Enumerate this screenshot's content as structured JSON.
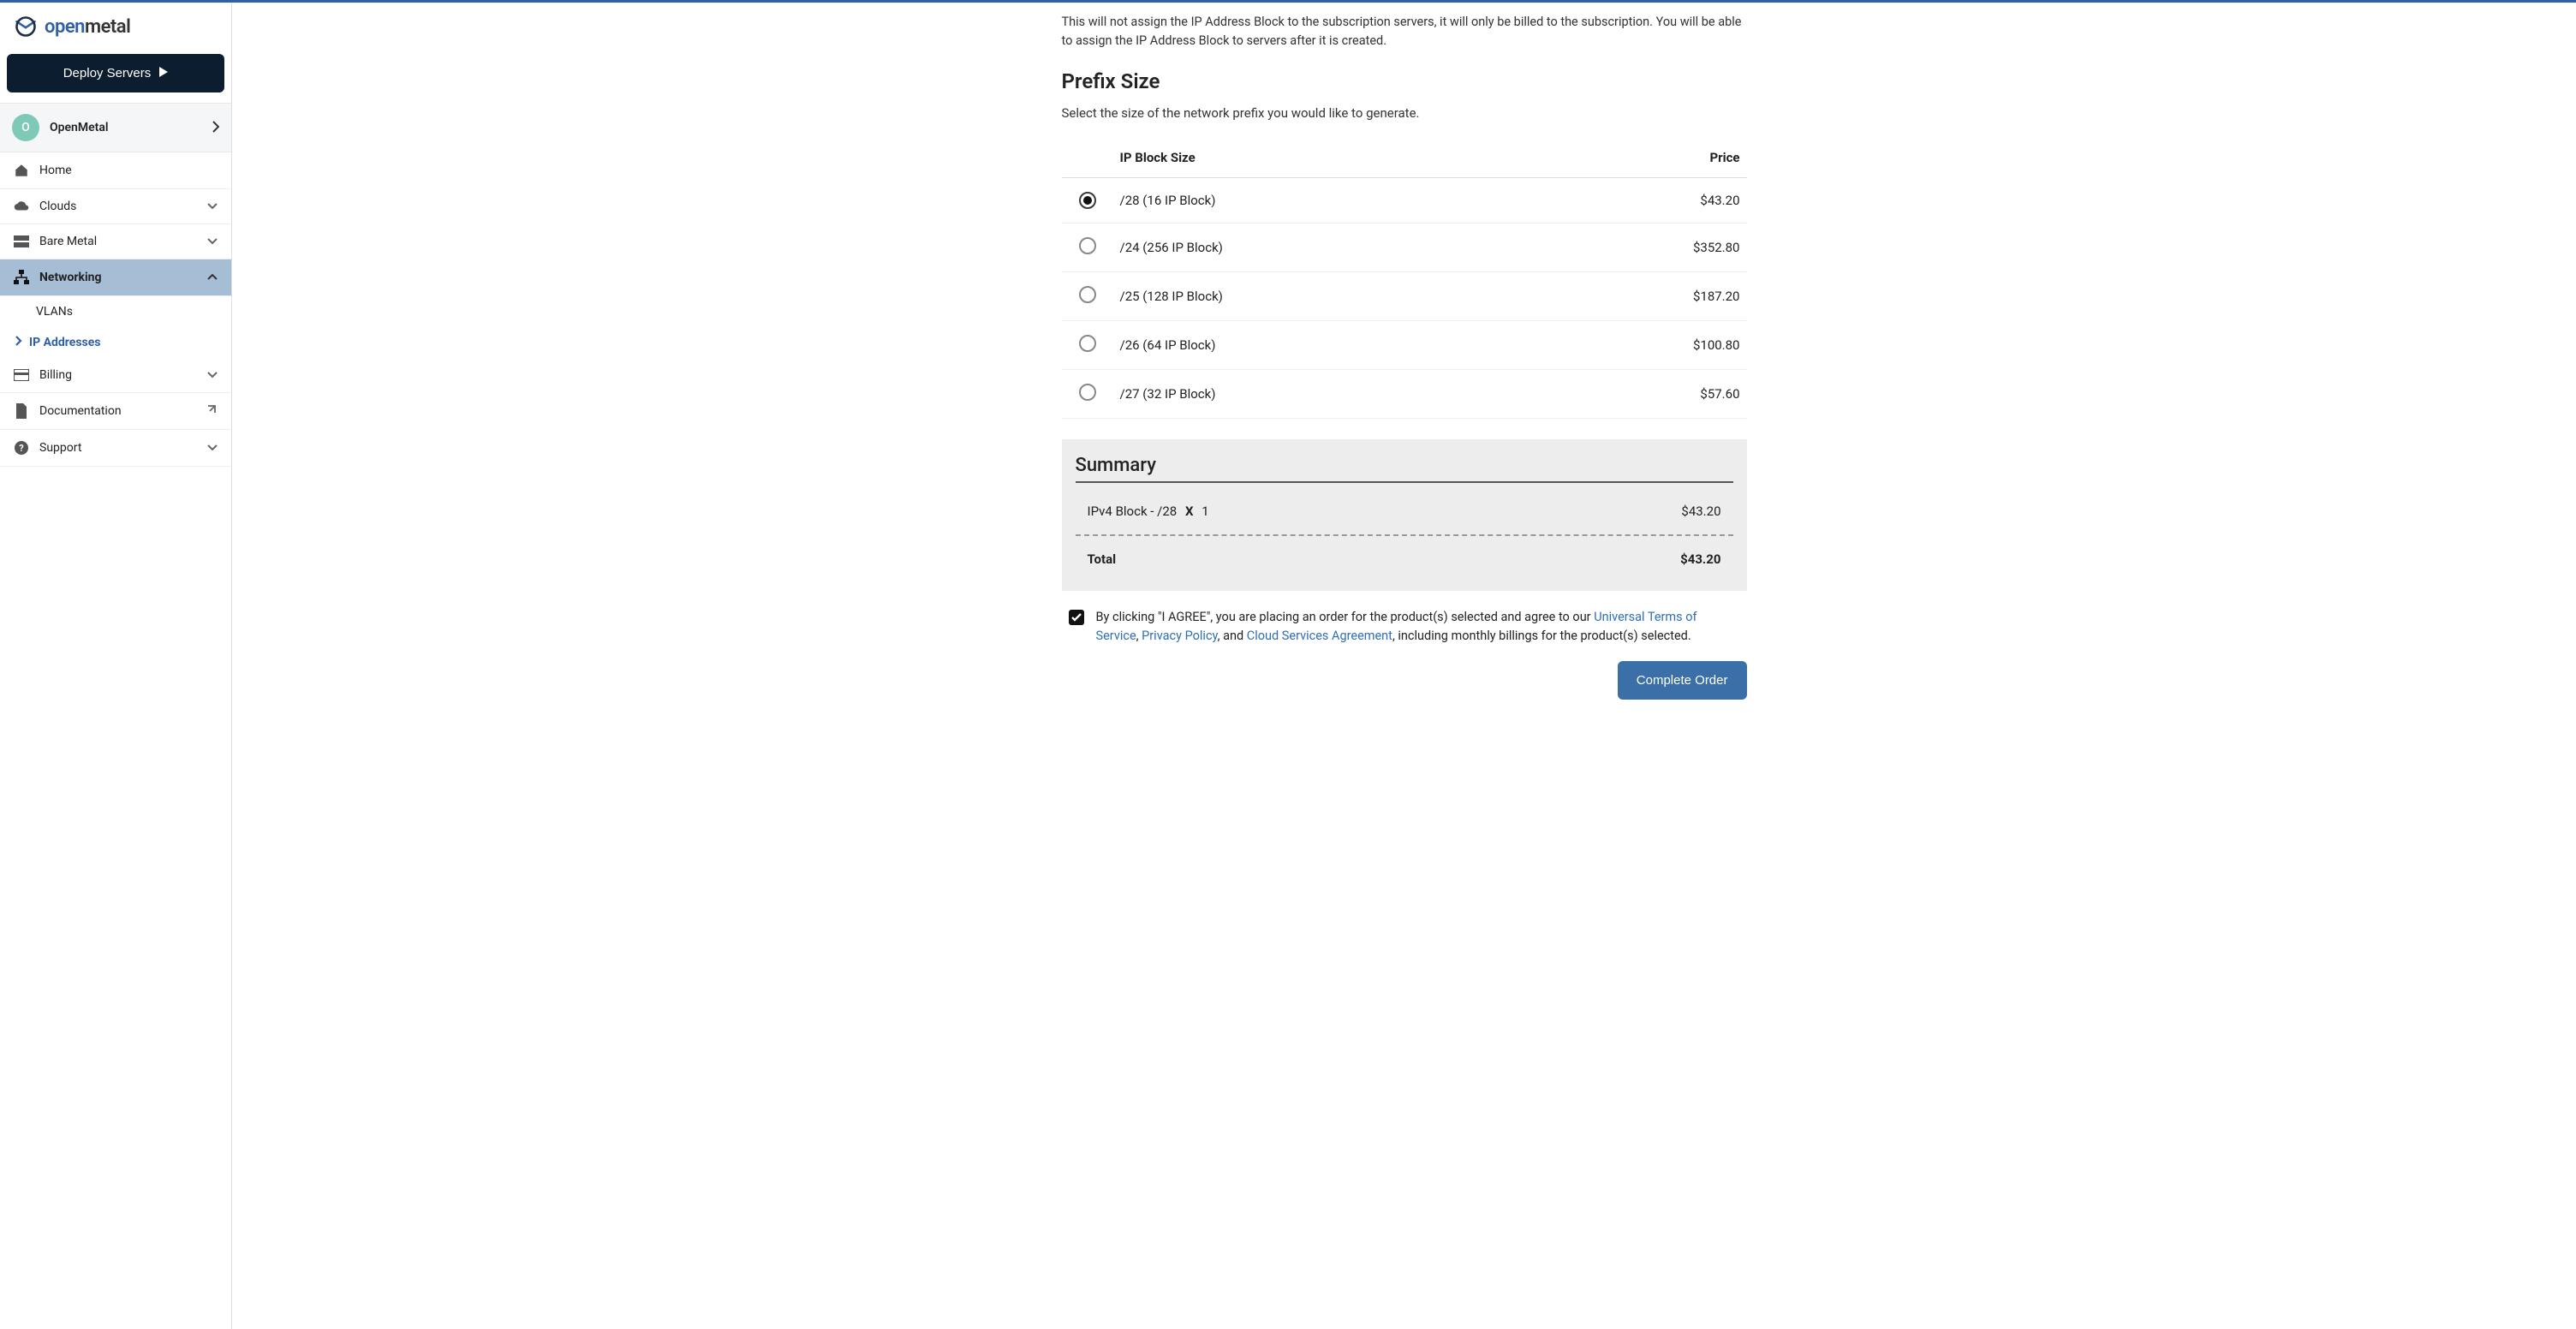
{
  "brand": {
    "open": "open",
    "metal": "metal"
  },
  "deploy_label": "Deploy Servers",
  "org": {
    "initial": "O",
    "name": "OpenMetal"
  },
  "nav": {
    "home": "Home",
    "clouds": "Clouds",
    "bare_metal": "Bare Metal",
    "networking": "Networking",
    "billing": "Billing",
    "documentation": "Documentation",
    "support": "Support"
  },
  "subnav": {
    "vlans": "VLANs",
    "ip_addresses": "IP Addresses"
  },
  "intro": "This will not assign the IP Address Block to the subscription servers, it will only be billed to the subscription. You will be able to assign the IP Address Block to servers after it is created.",
  "prefix_heading": "Prefix Size",
  "prefix_hint": "Select the size of the network prefix you would like to generate.",
  "table": {
    "col_size": "IP Block Size",
    "col_price": "Price",
    "rows": [
      {
        "label": "/28 (16 IP Block)",
        "price": "$43.20",
        "selected": true
      },
      {
        "label": "/24 (256 IP Block)",
        "price": "$352.80",
        "selected": false
      },
      {
        "label": "/25 (128 IP Block)",
        "price": "$187.20",
        "selected": false
      },
      {
        "label": "/26 (64 IP Block)",
        "price": "$100.80",
        "selected": false
      },
      {
        "label": "/27 (32 IP Block)",
        "price": "$57.60",
        "selected": false
      }
    ]
  },
  "summary": {
    "heading": "Summary",
    "line_item": "IPv4 Block - /28",
    "qty_sep": "X",
    "qty": "1",
    "line_price": "$43.20",
    "total_label": "Total",
    "total_price": "$43.20"
  },
  "agree": {
    "pre": "By clicking \"I AGREE\", you are placing an order for the product(s) selected and agree to our ",
    "link1": "Universal Terms of Service",
    "sep1": ", ",
    "link2": "Privacy Policy",
    "sep2": ", and ",
    "link3": "Cloud Services Agreement",
    "post": ", including monthly billings for the product(s) selected.",
    "checked": true
  },
  "complete_label": "Complete Order"
}
